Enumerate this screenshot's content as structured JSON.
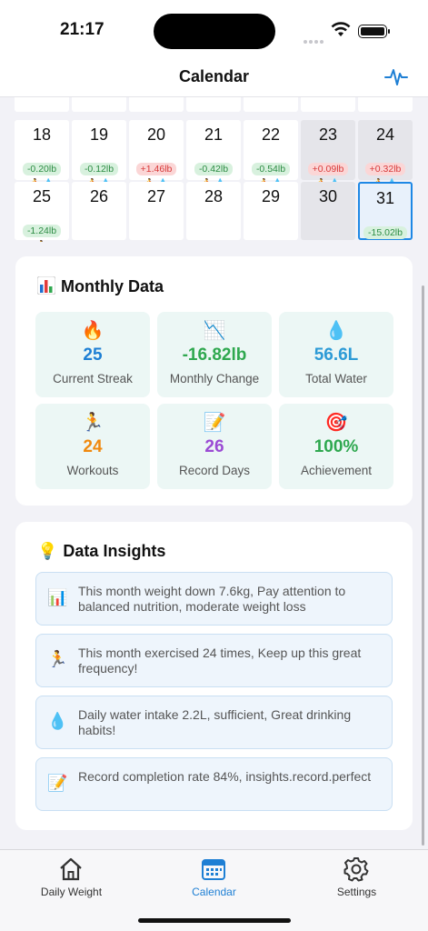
{
  "status_bar": {
    "time": "21:17"
  },
  "nav": {
    "title": "Calendar",
    "action_icon": "pulse-icon"
  },
  "calendar": {
    "rows": [
      {
        "days": [
          {
            "day": "",
            "icons": [
              "🏃",
              "💧"
            ],
            "state": "past"
          },
          {
            "day": "",
            "icons": [
              "🏃",
              "💧"
            ],
            "state": "past"
          },
          {
            "day": "",
            "icons": [
              "🏃",
              "💧"
            ],
            "state": "past"
          },
          {
            "day": "",
            "icons": [
              "🏃",
              "💧"
            ],
            "state": "past"
          },
          {
            "day": "",
            "icons": [
              "🏃",
              "💧"
            ],
            "state": "past"
          },
          {
            "day": "",
            "icons": [
              "🏃",
              "💧"
            ],
            "state": "past"
          },
          {
            "day": "",
            "icons": [
              "🏃",
              "💧"
            ],
            "state": "past"
          }
        ]
      },
      {
        "days": [
          {
            "day": "18",
            "change": "-0.20lb",
            "trend": "down",
            "icons": [
              "🏃",
              "💧"
            ],
            "state": "past"
          },
          {
            "day": "19",
            "change": "-0.12lb",
            "trend": "down",
            "icons": [
              "🏃",
              "💧"
            ],
            "state": "past"
          },
          {
            "day": "20",
            "change": "+1.46lb",
            "trend": "up",
            "icons": [
              "🏃",
              "💧"
            ],
            "state": "past"
          },
          {
            "day": "21",
            "change": "-0.42lb",
            "trend": "down",
            "icons": [
              "🏃",
              "💧"
            ],
            "state": "past"
          },
          {
            "day": "22",
            "change": "-0.54lb",
            "trend": "down",
            "icons": [
              "🏃",
              "💧"
            ],
            "state": "past"
          },
          {
            "day": "23",
            "change": "+0.09lb",
            "trend": "up",
            "icons": [
              "🏃",
              "💧"
            ],
            "state": "future"
          },
          {
            "day": "24",
            "change": "+0.32lb",
            "trend": "up",
            "icons": [
              "🏃",
              "💧"
            ],
            "state": "future"
          }
        ]
      },
      {
        "days": [
          {
            "day": "25",
            "change": "-1.24lb",
            "trend": "down",
            "icons": [
              "🏃"
            ],
            "state": "past"
          },
          {
            "day": "26",
            "state": "past"
          },
          {
            "day": "27",
            "state": "past"
          },
          {
            "day": "28",
            "state": "past"
          },
          {
            "day": "29",
            "state": "past"
          },
          {
            "day": "30",
            "state": "future"
          },
          {
            "day": "31",
            "change": "-15.02lb",
            "trend": "down",
            "icons": [
              "🏃",
              "💧"
            ],
            "state": "today"
          }
        ]
      }
    ]
  },
  "monthly": {
    "title": "Monthly Data",
    "stats": [
      {
        "icon": "🔥",
        "icon_name": "fire-icon",
        "value": "25",
        "label": "Current Streak",
        "color": "#1e7fd4"
      },
      {
        "icon": "📉",
        "icon_name": "chart-down-icon",
        "value": "-16.82lb",
        "label": "Monthly Change",
        "color": "#2fa84f"
      },
      {
        "icon": "💧",
        "icon_name": "droplet-icon",
        "value": "56.6L",
        "label": "Total Water",
        "color": "#2d9bd6"
      },
      {
        "icon": "🏃",
        "icon_name": "runner-icon",
        "value": "24",
        "label": "Workouts",
        "color": "#f0890e"
      },
      {
        "icon": "📝",
        "icon_name": "memo-icon",
        "value": "26",
        "label": "Record Days",
        "color": "#9b4bd4"
      },
      {
        "icon": "🎯",
        "icon_name": "target-icon",
        "value": "100%",
        "label": "Achievement",
        "color": "#2fa84f"
      }
    ]
  },
  "insights": {
    "title": "Data Insights",
    "items": [
      {
        "icon": "📊",
        "icon_name": "bar-chart-icon",
        "text": "This month weight down 7.6kg, Pay attention to balanced nutrition, moderate weight loss"
      },
      {
        "icon": "🏃",
        "icon_name": "runner-icon",
        "text": "This month exercised 24 times, Keep up this great frequency!"
      },
      {
        "icon": "💧",
        "icon_name": "droplet-icon",
        "text": "Daily water intake 2.2L, sufficient, Great drinking habits!"
      },
      {
        "icon": "📝",
        "icon_name": "memo-icon",
        "text": "Record completion rate 84%, insights.record.perfect"
      }
    ]
  },
  "tabs": [
    {
      "label": "Daily Weight",
      "icon": "house-icon",
      "active": false
    },
    {
      "label": "Calendar",
      "icon": "calendar-icon",
      "active": true
    },
    {
      "label": "Settings",
      "icon": "gear-icon",
      "active": false
    }
  ],
  "colors": {
    "accent": "#1e7fd4",
    "down": "#2c8c43",
    "up": "#d83a3a"
  }
}
